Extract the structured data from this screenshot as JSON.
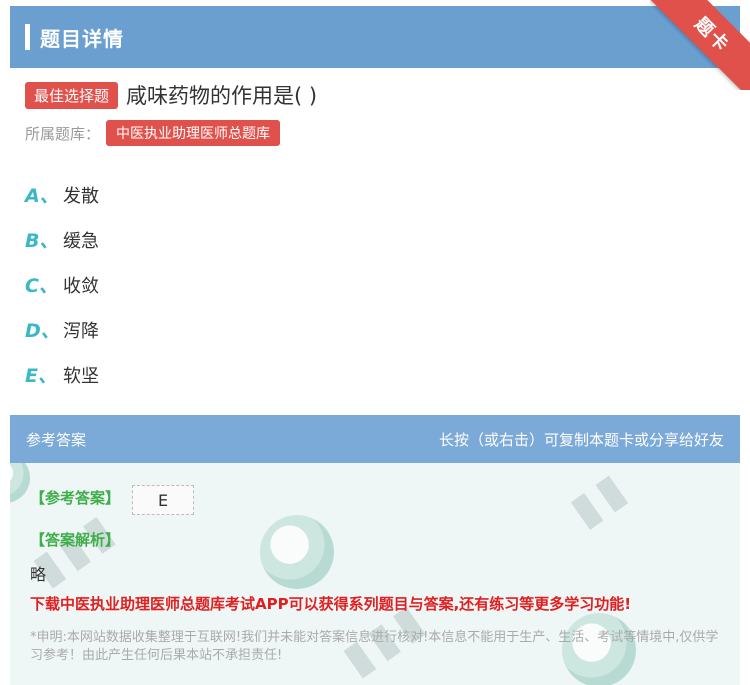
{
  "header": {
    "title": "题目详情"
  },
  "ribbon": {
    "label": "题卡"
  },
  "question": {
    "tag": "最佳选择题",
    "text": "咸味药物的作用是( )",
    "bank_label": "所属题库：",
    "bank_name": "中医执业助理医师总题库",
    "options": [
      {
        "letter": "A、",
        "text": "发散"
      },
      {
        "letter": "B、",
        "text": "缓急"
      },
      {
        "letter": "C、",
        "text": "收敛"
      },
      {
        "letter": "D、",
        "text": "泻降"
      },
      {
        "letter": "E、",
        "text": "软坚"
      }
    ]
  },
  "answer": {
    "header_left": "参考答案",
    "header_right": "长按（或右击）可复制本题卡或分享给好友",
    "key_label": "【参考答案】",
    "key_value": "E",
    "analysis_label": "【答案解析】",
    "analysis_text": "略",
    "promo": "下载中医执业助理医师总题库考试APP可以获得系列题目与答案,还有练习等更多学习功能!",
    "disclaimer": "*申明:本网站数据收集整理于互联网!我们并未能对答案信息进行核对!本信息不能用于生产、生活、考试等情境中,仅供学习参考！由此产生任何后果本站不承担责任!"
  }
}
